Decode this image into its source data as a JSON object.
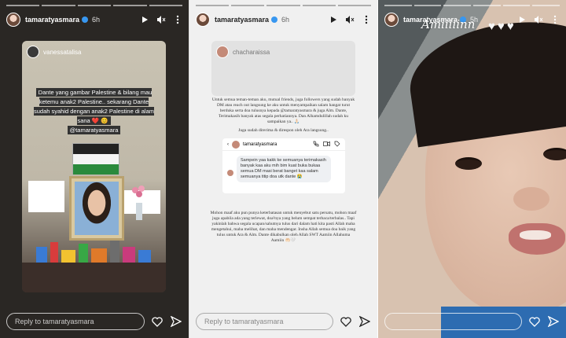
{
  "panels": [
    {
      "username": "tamaratyasmara",
      "time": "6h",
      "reply_placeholder": "Reply to tamaratyasmara",
      "repost": {
        "username": "vanessatalisa",
        "caption": "Dante yang gambar Palestine & bilang mau ketemu anak2 Palestine.. sekarang Dante sudah syahid dengan anak2 Palestine di alam sana ❤️ 😊",
        "mention": "@tamaratyasmara"
      }
    },
    {
      "username": "tamaratyasmara",
      "time": "6h",
      "reply_placeholder": "Reply to tamaratyasmara",
      "repost": {
        "username": "chacharaissa"
      },
      "message_part1": "Untuk semua teman-teman aku, mutual friends, juga followers yang sudah banyak DM atau reach out langsung ke aku untuk menyampaikan salam hangat turut berduka serta doa tulusnya kepada @tamaratyasmara & juga Alm. Dante, Terimakasih banyak atas segala perhatiannya. Dan Alhamdulillah sudah ku sampaikan ya.. 🙏🏻",
      "message_part1b": "Juga sudah direrima & direspon oleh Ara langsung..",
      "chat": {
        "username": "tamaratyasmara",
        "bubble": "Sampein yaa kakk ke semuanya terimakasih banyak kaa aku mih bim kuat buka bukaa semua DM masi berat banget kaa salam semuanya titip doa utk dante 😭"
      },
      "message_part2": "Mohon maaf aku pun punya keterbatasan untuk menyebut satu persatu, mohon maaf juga apabila ada yang terlewat, doa²nya yang belum sempat terbaca/terbalas.. Tapi yakinlah bahwa segala ucapan/sahutnya tulus dari dalam hati kita pasti Allah maha mengetahui, maha melihat, dan maha mendengar. Insha Allah semua doa baik yang tulus untuk Ara & Alm. Dante dikabulkan oleh Allah SWT Aamiin Allahuma Aamiin 🤲🏻🤍"
    },
    {
      "username": "tamaratyasmara",
      "time": "5h",
      "reply_placeholder": "",
      "overlay_text": "Amiiiiinn"
    }
  ],
  "colors": {
    "verified": "#3897f0"
  }
}
